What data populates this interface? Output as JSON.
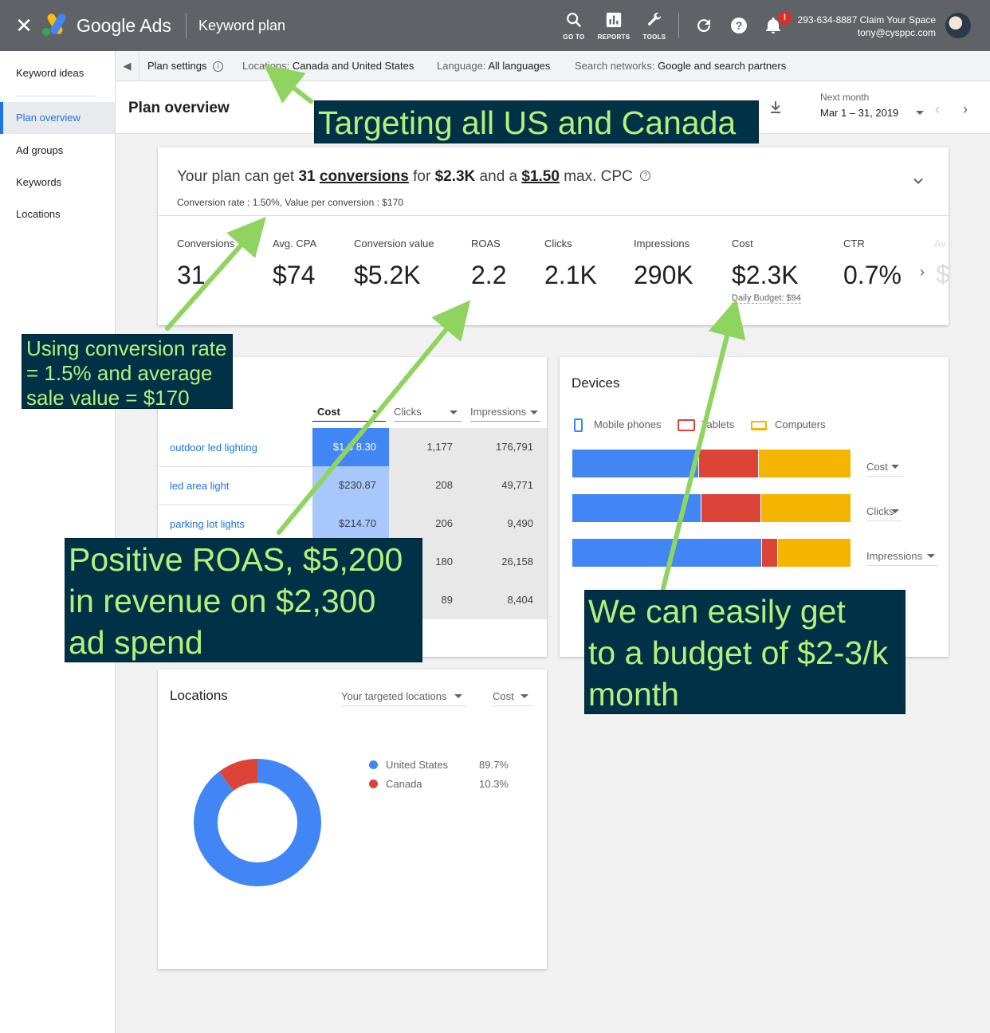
{
  "topbar": {
    "brand": "Google Ads",
    "page_title": "Keyword plan",
    "tools": [
      {
        "label": "GO TO",
        "icon": "search-icon"
      },
      {
        "label": "REPORTS",
        "icon": "reports-icon"
      },
      {
        "label": "TOOLS",
        "icon": "wrench-icon"
      }
    ],
    "notification_badge": "!",
    "account_line1": "293-634-8887 Claim Your Space",
    "account_line2": "tony@cysppc.com"
  },
  "sidebar": {
    "items": [
      {
        "label": "Keyword ideas"
      },
      {
        "label": "Plan overview"
      },
      {
        "label": "Ad groups"
      },
      {
        "label": "Keywords"
      },
      {
        "label": "Locations"
      }
    ]
  },
  "settings": {
    "plan_settings": "Plan settings",
    "locations_label": "Locations:",
    "locations_value": "Canada and United States",
    "language_label": "Language:",
    "language_value": "All languages",
    "networks_label": "Search networks:",
    "networks_value": "Google and search partners"
  },
  "header": {
    "title": "Plan overview",
    "period_label": "Next month",
    "date_range": "Mar 1 – 31, 2019"
  },
  "summary": {
    "t1": "Your plan can get ",
    "conv": "31",
    "t2": " ",
    "conv_word": "conversions",
    "t3": " for ",
    "cost": "$2.3K",
    "t4": " and a ",
    "cpc": "$1.50",
    "t5": " max. CPC",
    "subline": "Conversion rate : 1.50%, Value per conversion : $170",
    "metrics": [
      {
        "label": "Conversions",
        "value": "31"
      },
      {
        "label": "Avg. CPA",
        "value": "$74"
      },
      {
        "label": "Conversion value",
        "value": "$5.2K"
      },
      {
        "label": "ROAS",
        "value": "2.2"
      },
      {
        "label": "Clicks",
        "value": "2.1K"
      },
      {
        "label": "Impressions",
        "value": "290K"
      },
      {
        "label": "Cost",
        "value": "$2.3K"
      },
      {
        "label": "CTR",
        "value": "0.7%"
      }
    ],
    "daily_budget": "Daily Budget: $94",
    "faded_label": "Av",
    "faded_value": "$"
  },
  "keywords_table": {
    "headers": {
      "cost": "Cost",
      "clicks": "Clicks",
      "impressions": "Impressions"
    },
    "rows": [
      {
        "keyword": "outdoor led lighting",
        "cost": "$1,3 8.30",
        "clicks": "1,177",
        "impressions": "176,791"
      },
      {
        "keyword": "led area light",
        "cost": "$230.87",
        "clicks": "208",
        "impressions": "49,771"
      },
      {
        "keyword": "parking lot lights",
        "cost": "$214.70",
        "clicks": "206",
        "impressions": "9,490"
      },
      {
        "keyword": "",
        "cost": "",
        "clicks": "180",
        "impressions": "26,158"
      },
      {
        "keyword": "",
        "cost": "",
        "clicks": "89",
        "impressions": "8,404"
      }
    ]
  },
  "devices": {
    "title": "Devices",
    "legend": [
      "Mobile phones",
      "Tablets",
      "Computers"
    ],
    "colors": {
      "mobile": "#4285f4",
      "tablet": "#db4437",
      "computer": "#f4b400"
    },
    "bars": [
      {
        "label": "Cost",
        "mobile": 0.55,
        "tablet": 0.26,
        "computer": 0.4
      },
      {
        "label": "Clicks",
        "mobile": 0.56,
        "tablet": 0.26,
        "computer": 0.39
      },
      {
        "label": "Impressions",
        "mobile": 0.83,
        "tablet": 0.07,
        "computer": 0.32
      }
    ]
  },
  "locations": {
    "title": "Locations",
    "select1": "Your targeted locations",
    "select2": "Cost",
    "items": [
      {
        "name": "United States",
        "pct": "89.7%",
        "value": 89.7,
        "color": "#4285f4"
      },
      {
        "name": "Canada",
        "pct": "10.3%",
        "value": 10.3,
        "color": "#db4437"
      }
    ]
  },
  "annotations": {
    "targeting": "Targeting all US and Canada",
    "conv_rate": [
      "Using conversion rate",
      "= 1.5% and average",
      "sale value = $170"
    ],
    "roas": [
      "Positive ROAS, $5,200",
      "in revenue on $2,300",
      "ad spend"
    ],
    "budget": [
      "We can easily get",
      "to a budget of $2-3/k",
      "month"
    ]
  }
}
